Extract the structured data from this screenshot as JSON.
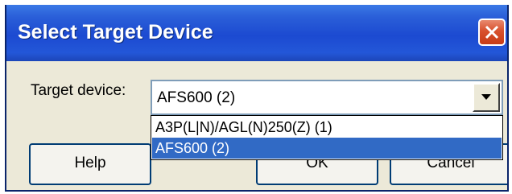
{
  "dialog": {
    "title": "Select Target Device"
  },
  "target_device": {
    "label": "Target device:",
    "selected_value": "AFS600 (2)",
    "options": [
      "A3P(L|N)/AGL(N)250(Z) (1)",
      "AFS600 (2)"
    ],
    "highlighted_index": 1
  },
  "buttons": {
    "help": "Help",
    "ok": "OK",
    "cancel": "Cancel"
  },
  "colors": {
    "titlebar": "#2357d8",
    "selection": "#316ac5",
    "close": "#d8512d"
  }
}
